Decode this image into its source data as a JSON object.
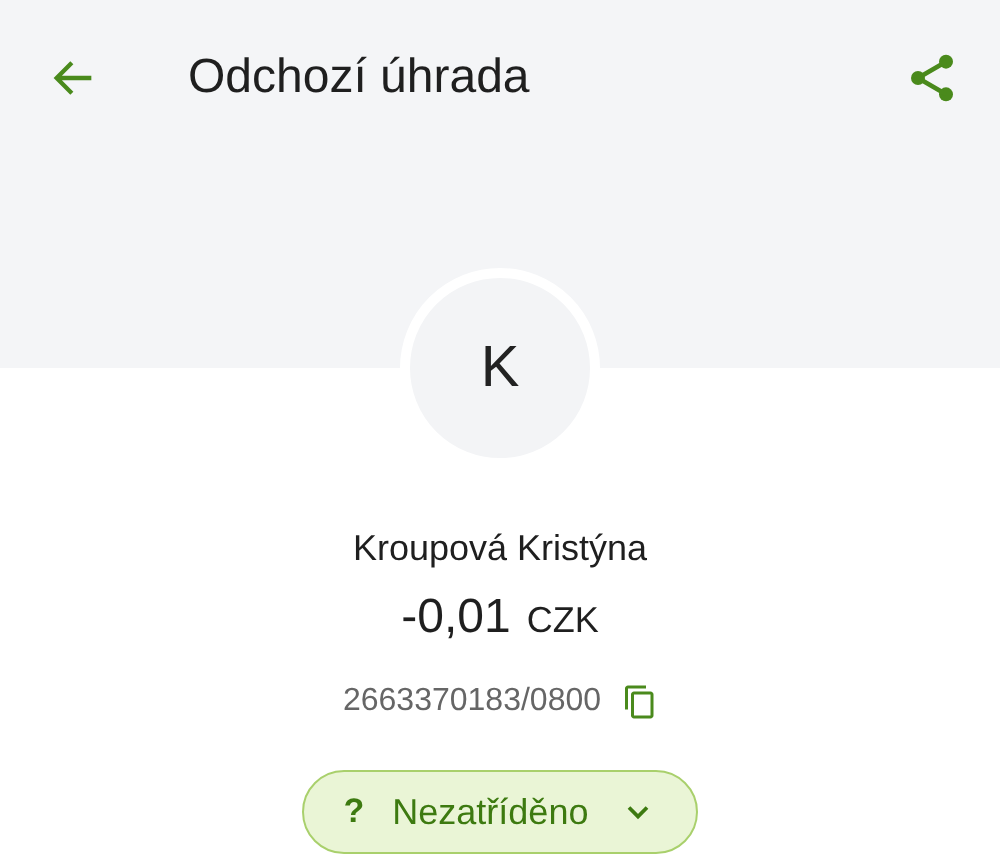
{
  "top_bar": {
    "title": "Odchozí úhrada"
  },
  "counterparty": {
    "initial": "K",
    "name": "Kroupová Kristýna",
    "amount": "-0,01",
    "currency": "CZK",
    "account": "2663370183/0800"
  },
  "category_chip": {
    "symbol": "?",
    "label": "Nezatříděno"
  }
}
